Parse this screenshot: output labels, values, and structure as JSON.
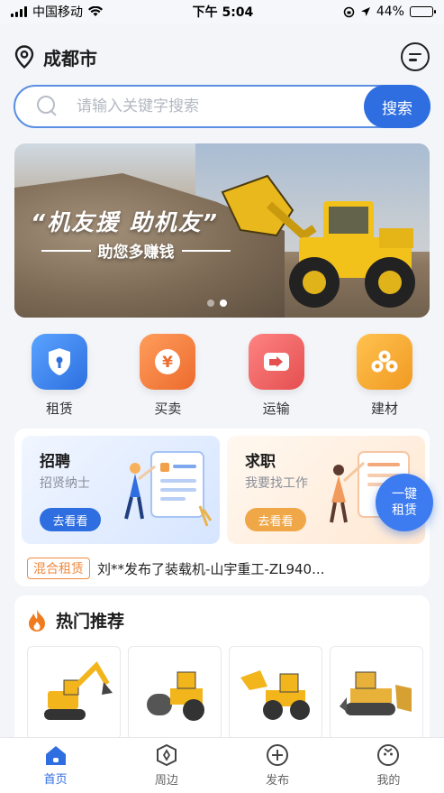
{
  "status_bar": {
    "carrier": "中国移动",
    "time": "下午 5:04",
    "battery": "44%"
  },
  "header": {
    "city": "成都市"
  },
  "search": {
    "placeholder": "请输入关键字搜索",
    "button_label": "搜索"
  },
  "banner": {
    "slogan": "“机友援 助机友”",
    "subtitle": "助您多赚钱",
    "active_dot": 2,
    "dot_count": 2
  },
  "categories": [
    {
      "label": "租赁",
      "icon": "shield-icon",
      "color": "#3d86ef"
    },
    {
      "label": "买卖",
      "icon": "yuan-icon",
      "color": "#f07a3c"
    },
    {
      "label": "运输",
      "icon": "truck-icon",
      "color": "#ee5e5e"
    },
    {
      "label": "建材",
      "icon": "materials-icon",
      "color": "#f4a93b"
    }
  ],
  "jobs": {
    "hire": {
      "title": "招聘",
      "subtitle": "招贤纳士",
      "button": "去看看"
    },
    "seek": {
      "title": "求职",
      "subtitle": "我要找工作",
      "button": "去看看"
    }
  },
  "news": {
    "tag": "混合租赁",
    "text": "刘**发布了装载机-山宇重工-ZL940..."
  },
  "float_button": {
    "line1": "一键",
    "line2": "租赁"
  },
  "hot": {
    "title": "热门推荐",
    "items": [
      "excavator",
      "road-roller",
      "wheel-loader",
      "bulldozer"
    ]
  },
  "tabbar": {
    "tabs": [
      {
        "label": "首页",
        "active": true
      },
      {
        "label": "周边",
        "active": false
      },
      {
        "label": "发布",
        "active": false
      },
      {
        "label": "我的",
        "active": false
      }
    ]
  },
  "colors": {
    "primary": "#2f6ee0",
    "accent_orange": "#f08a3e"
  }
}
